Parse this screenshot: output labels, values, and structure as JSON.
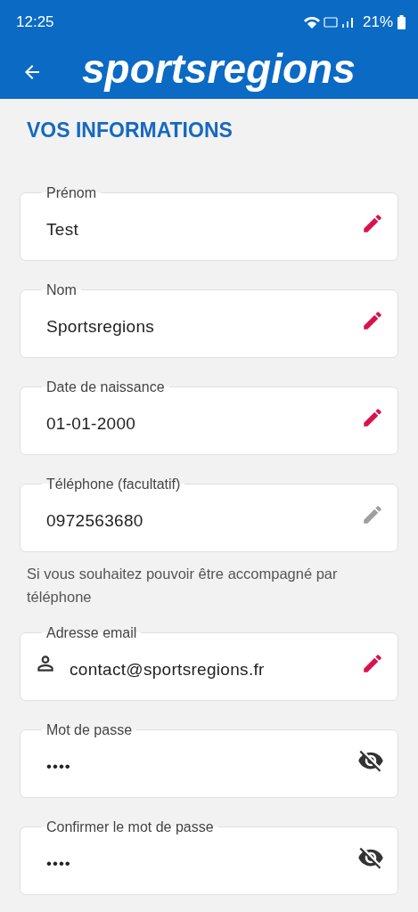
{
  "status_bar": {
    "time": "12:25",
    "battery": "21%"
  },
  "app_bar": {
    "logo": "sportsregions"
  },
  "section_title": "VOS INFORMATIONS",
  "fields": [
    {
      "kind": "edit",
      "label": "Prénom",
      "value": "Test",
      "editable": true
    },
    {
      "kind": "edit",
      "label": "Nom",
      "value": "Sportsregions",
      "editable": true
    },
    {
      "kind": "edit",
      "label": "Date de naissance",
      "value": "01-01-2000",
      "editable": true
    },
    {
      "kind": "edit",
      "label": "Téléphone (facultatif)",
      "value": "0972563680",
      "editable": false,
      "helper": "Si vous souhaitez pouvoir être accompagné par téléphone"
    },
    {
      "kind": "email",
      "label": "Adresse email",
      "value": "contact@sportsregions.fr",
      "editable": true
    },
    {
      "kind": "password",
      "label": "Mot de passe",
      "value": "••••"
    },
    {
      "kind": "password",
      "label": "Confirmer le mot de passe",
      "value": "••••"
    }
  ]
}
